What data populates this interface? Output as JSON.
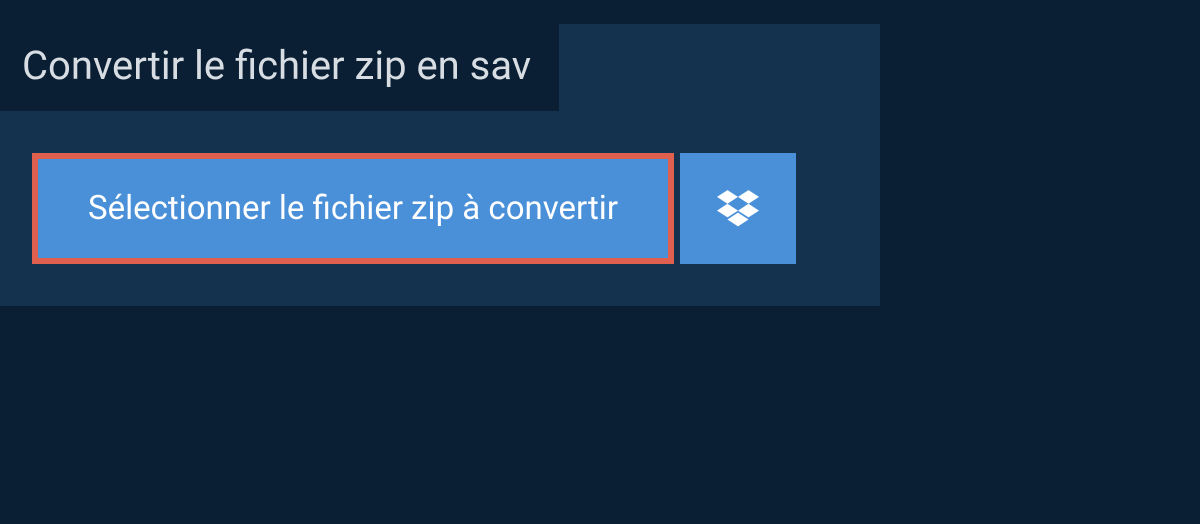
{
  "header": {
    "title": "Convertir le fichier zip en sav"
  },
  "actions": {
    "select_file_label": "Sélectionner le fichier zip à convertir"
  },
  "colors": {
    "page_bg": "#0a1f33",
    "panel_bg": "#14314d",
    "button_bg": "#4a90d9",
    "highlight_border": "#e0604f",
    "text_light": "#ffffff",
    "title_text": "#d7dde3"
  }
}
